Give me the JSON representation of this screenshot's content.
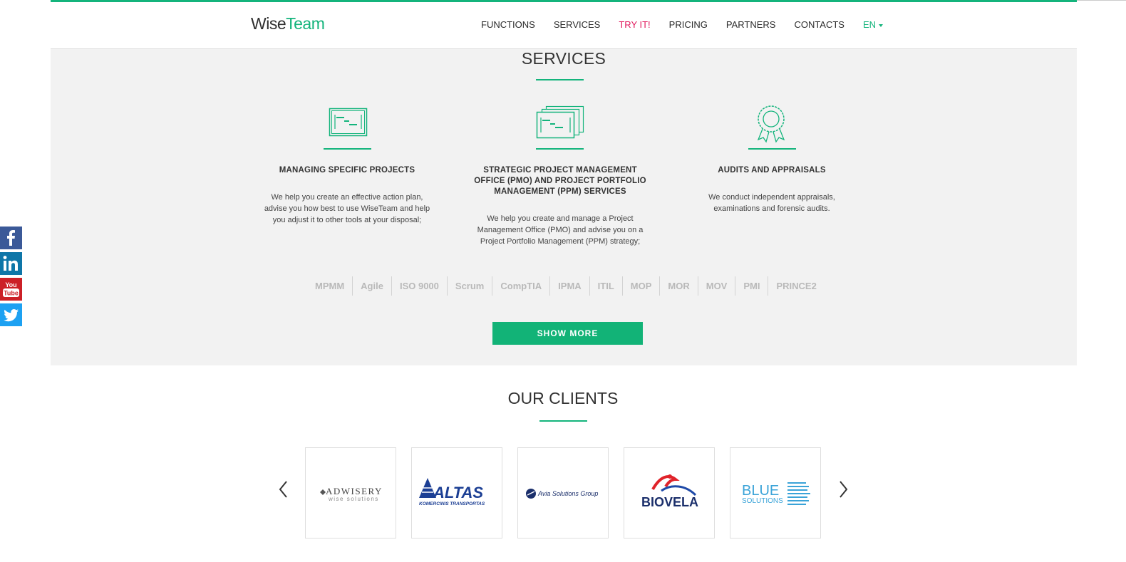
{
  "header": {
    "logo_wise": "Wise",
    "logo_team": "Team",
    "nav": [
      {
        "label": "FUNCTIONS"
      },
      {
        "label": "SERVICES"
      },
      {
        "label": "TRY IT!"
      },
      {
        "label": "PRICING"
      },
      {
        "label": "PARTNERS"
      },
      {
        "label": "CONTACTS"
      }
    ],
    "language": "EN"
  },
  "services": {
    "title": "SERVICES",
    "items": [
      {
        "title": "MANAGING SPECIFIC PROJECTS",
        "text": "We help you create an effective action plan, advise you how best to use WiseTeam and help you adjust it to other tools at your disposal;",
        "icon": "gantt-board-icon"
      },
      {
        "title": "STRATEGIC PROJECT MANAGEMENT OFFICE (PMO) AND PROJECT PORTFOLIO MANAGEMENT (PPM) SERVICES",
        "text": "We help you create and manage a Project Management Office (PMO) and advise you on a Project Portfolio Management (PPM) strategy;",
        "icon": "stacked-gantt-boards-icon"
      },
      {
        "title": "AUDITS AND APPRAISALS",
        "text": "We conduct independent appraisals, examinations and forensic audits.",
        "icon": "award-ribbon-icon"
      }
    ],
    "standards": [
      "MPMM",
      "Agile",
      "ISO 9000",
      "Scrum",
      "CompTIA",
      "IPMA",
      "ITIL",
      "MOP",
      "MOR",
      "MOV",
      "PMI",
      "PRINCE2"
    ],
    "show_more": "SHOW MORE"
  },
  "social": [
    "facebook-icon",
    "linkedin-icon",
    "youtube-icon",
    "twitter-icon"
  ],
  "clients": {
    "title": "OUR CLIENTS",
    "logos": [
      {
        "name": "ADWISERY",
        "tagline": "wise solutions"
      },
      {
        "name": "ALTAS",
        "tagline": "KOMERCINIS TRANSPORTAS"
      },
      {
        "name": "Avia Solutions Group",
        "tagline": ""
      },
      {
        "name": "BIOVELA",
        "tagline": ""
      },
      {
        "name": "BLUE",
        "tagline": "SOLUTIONS"
      }
    ]
  },
  "colors": {
    "accent": "#14b47c",
    "try_it": "#e0185c",
    "button": "#12b377",
    "section_bg": "#f2f2f2"
  }
}
